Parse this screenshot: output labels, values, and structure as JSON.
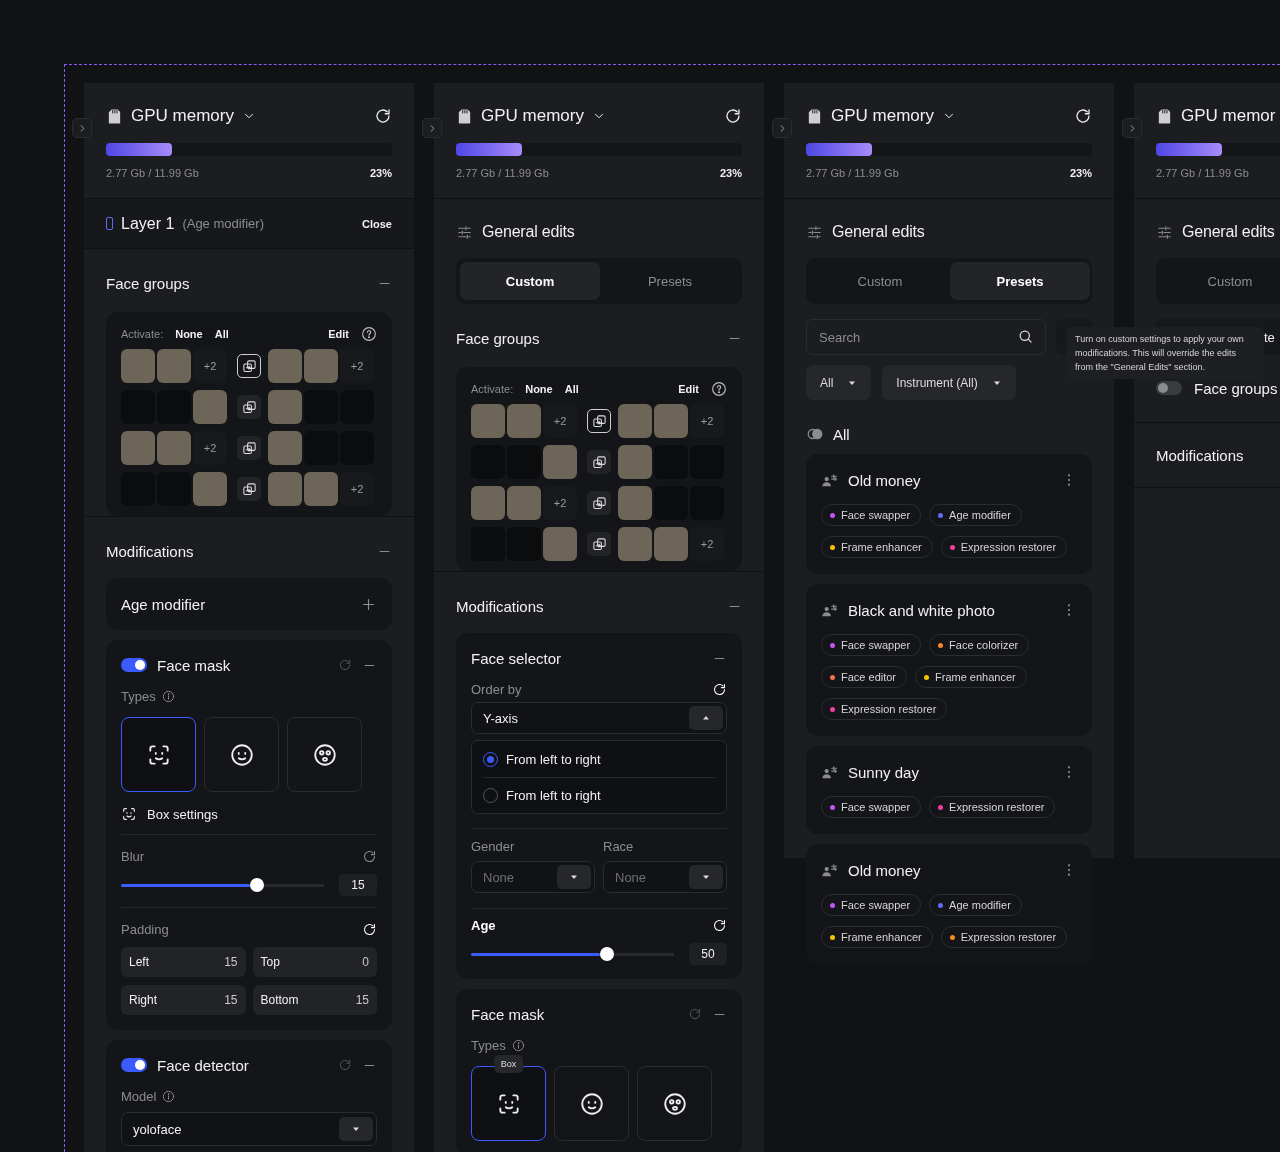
{
  "panels": [
    {
      "gpu": {
        "title": "GPU memory",
        "caret": true,
        "refresh": true,
        "level": 0.23,
        "usage": "2.77 Gb / 11.99 Gb",
        "percent": "23%"
      },
      "sections": [
        {
          "kind": "layer",
          "title": "Layer 1",
          "subtitle": "(Age modifier)",
          "action": "Close"
        },
        {
          "kind": "face_groups",
          "title": "Face groups",
          "activate_label": "Activate:",
          "options": [
            "None",
            "All"
          ],
          "edit": "Edit",
          "rows": [
            {
              "left": [
                {
                  "kind": "photo"
                },
                {
                  "kind": "photo"
                },
                {
                  "kind": "more",
                  "text": "+2"
                }
              ],
              "link_selected": true,
              "right": [
                {
                  "kind": "photo"
                },
                {
                  "kind": "photo"
                },
                {
                  "kind": "more",
                  "text": "+2"
                }
              ]
            },
            {
              "left": [
                {
                  "kind": "empty"
                },
                {
                  "kind": "empty"
                },
                {
                  "kind": "photo"
                }
              ],
              "link_selected": false,
              "right": [
                {
                  "kind": "photo"
                },
                {
                  "kind": "empty"
                },
                {
                  "kind": "empty"
                }
              ]
            },
            {
              "left": [
                {
                  "kind": "photo"
                },
                {
                  "kind": "photo"
                },
                {
                  "kind": "more",
                  "text": "+2"
                }
              ],
              "link_selected": false,
              "right": [
                {
                  "kind": "photo"
                },
                {
                  "kind": "empty"
                },
                {
                  "kind": "empty"
                }
              ]
            },
            {
              "left": [
                {
                  "kind": "empty"
                },
                {
                  "kind": "empty"
                },
                {
                  "kind": "photo"
                }
              ],
              "link_selected": false,
              "right": [
                {
                  "kind": "photo"
                },
                {
                  "kind": "photo"
                },
                {
                  "kind": "more",
                  "text": "+2"
                }
              ]
            }
          ]
        },
        {
          "kind": "modifications",
          "title": "Modifications",
          "items": [
            {
              "kind": "add",
              "title": "Age modifier"
            },
            {
              "kind": "face_mask",
              "title": "Face mask",
              "on": true,
              "types_label": "Types",
              "types": [
                {
                  "kind": "box",
                  "selected": true
                },
                {
                  "kind": "face",
                  "selected": false
                },
                {
                  "kind": "mask",
                  "selected": false
                }
              ],
              "box_settings": "Box settings",
              "blur": {
                "label": "Blur",
                "level": 0.67,
                "value": "15"
              },
              "padding": {
                "label": "Padding",
                "fields": [
                  {
                    "label": "Left",
                    "value": "15"
                  },
                  {
                    "label": "Top",
                    "value": "0"
                  },
                  {
                    "label": "Right",
                    "value": "15"
                  },
                  {
                    "label": "Bottom",
                    "value": "15"
                  }
                ]
              }
            },
            {
              "kind": "face_detector",
              "title": "Face detector",
              "on": true,
              "model_label": "Model",
              "model": "yoloface"
            }
          ]
        }
      ]
    },
    {
      "gpu": {
        "title": "GPU memory",
        "caret": true,
        "refresh": true,
        "level": 0.23,
        "usage": "2.77 Gb / 11.99 Gb",
        "percent": "23%"
      },
      "sections": [
        {
          "kind": "general_edits",
          "title": "General edits",
          "tabs": [
            {
              "label": "Custom",
              "selected": true
            },
            {
              "label": "Presets",
              "selected": false
            }
          ]
        },
        {
          "kind": "face_groups",
          "title": "Face groups",
          "activate_label": "Activate:",
          "options": [
            "None",
            "All"
          ],
          "edit": "Edit",
          "rows": [
            {
              "left": [
                {
                  "kind": "photo"
                },
                {
                  "kind": "photo"
                },
                {
                  "kind": "more",
                  "text": "+2"
                }
              ],
              "link_selected": true,
              "right": [
                {
                  "kind": "photo"
                },
                {
                  "kind": "photo"
                },
                {
                  "kind": "more",
                  "text": "+2"
                }
              ]
            },
            {
              "left": [
                {
                  "kind": "empty"
                },
                {
                  "kind": "empty"
                },
                {
                  "kind": "photo"
                }
              ],
              "link_selected": false,
              "right": [
                {
                  "kind": "photo"
                },
                {
                  "kind": "empty"
                },
                {
                  "kind": "empty"
                }
              ]
            },
            {
              "left": [
                {
                  "kind": "photo"
                },
                {
                  "kind": "photo"
                },
                {
                  "kind": "more",
                  "text": "+2"
                }
              ],
              "link_selected": false,
              "right": [
                {
                  "kind": "photo"
                },
                {
                  "kind": "empty"
                },
                {
                  "kind": "empty"
                }
              ]
            },
            {
              "left": [
                {
                  "kind": "empty"
                },
                {
                  "kind": "empty"
                },
                {
                  "kind": "photo"
                }
              ],
              "link_selected": false,
              "right": [
                {
                  "kind": "photo"
                },
                {
                  "kind": "photo"
                },
                {
                  "kind": "more",
                  "text": "+2"
                }
              ]
            }
          ]
        },
        {
          "kind": "modifications",
          "title": "Modifications",
          "items": [
            {
              "kind": "face_selector",
              "title": "Face selector",
              "order_label": "Order by",
              "order_value": "Y-axis",
              "expanded": true,
              "options": [
                {
                  "label": "From left to right",
                  "selected": true
                },
                {
                  "label": "From left to right",
                  "selected": false
                }
              ],
              "gender_label": "Gender",
              "gender_placeholder": "None",
              "race_label": "Race",
              "race_placeholder": "None",
              "age": {
                "label": "Age",
                "level": 0.67,
                "value": "50"
              }
            },
            {
              "kind": "face_mask",
              "title": "Face mask",
              "types_label": "Types",
              "types": [
                {
                  "kind": "box",
                  "selected": true,
                  "tooltip": "Box"
                },
                {
                  "kind": "face",
                  "selected": false
                },
                {
                  "kind": "mask",
                  "selected": false
                }
              ]
            }
          ]
        }
      ]
    },
    {
      "gpu": {
        "title": "GPU memory",
        "caret": true,
        "refresh": true,
        "level": 0.23,
        "usage": "2.77 Gb / 11.99 Gb",
        "percent": "23%"
      },
      "tooltip": "Turn on custom settings to apply your own modifications. This will override the edits from the \"General Edits\" section.",
      "sections": [
        {
          "kind": "general_edits",
          "title": "General edits",
          "tabs": [
            {
              "label": "Custom",
              "selected": false
            },
            {
              "label": "Presets",
              "selected": true
            }
          ]
        },
        {
          "kind": "presets",
          "search_placeholder": "Search",
          "filters": [
            "All",
            "Instrument (All)"
          ],
          "group": "All",
          "cards": [
            {
              "title": "Old money",
              "tags": [
                {
                  "label": "Face swapper",
                  "color": "#c355f5"
                },
                {
                  "label": "Age modifier",
                  "color": "#5f6cf6"
                },
                {
                  "label": "Frame enhancer",
                  "color": "#f5c400"
                },
                {
                  "label": "Expression restorer",
                  "color": "#f2409c"
                }
              ]
            },
            {
              "title": "Black and white photo",
              "tags": [
                {
                  "label": "Face swapper",
                  "color": "#c355f5"
                },
                {
                  "label": "Face colorizer",
                  "color": "#f5882a"
                },
                {
                  "label": "Face editor",
                  "color": "#f0704f"
                },
                {
                  "label": "Frame enhancer",
                  "color": "#f5c400"
                },
                {
                  "label": "Expression restorer",
                  "color": "#f2409c"
                }
              ]
            },
            {
              "title": "Sunny day",
              "tags": [
                {
                  "label": "Face swapper",
                  "color": "#c355f5"
                },
                {
                  "label": "Expression restorer",
                  "color": "#f2409c"
                }
              ]
            },
            {
              "title": "Old money",
              "tags": [
                {
                  "label": "Face swapper",
                  "color": "#c355f5"
                },
                {
                  "label": "Age modifier",
                  "color": "#5f6cf6"
                },
                {
                  "label": "Frame enhancer",
                  "color": "#f5c400"
                },
                {
                  "label": "Expression restorer",
                  "color": "#f5882a"
                }
              ]
            }
          ]
        }
      ]
    },
    {
      "gpu": {
        "title": "GPU memor",
        "caret": false,
        "refresh": false,
        "level": 0.23,
        "usage": "2.77 Gb / 11.99 Gb"
      },
      "sections": [
        {
          "kind": "general_edits",
          "title": "General edits",
          "tabs": [
            {
              "label": "Custom",
              "selected": false
            }
          ]
        },
        {
          "kind": "text_row",
          "text": "te"
        },
        {
          "kind": "toggle_row",
          "title": "Face groups",
          "on": false
        },
        {
          "kind": "heading",
          "title": "Modifications"
        }
      ]
    }
  ]
}
